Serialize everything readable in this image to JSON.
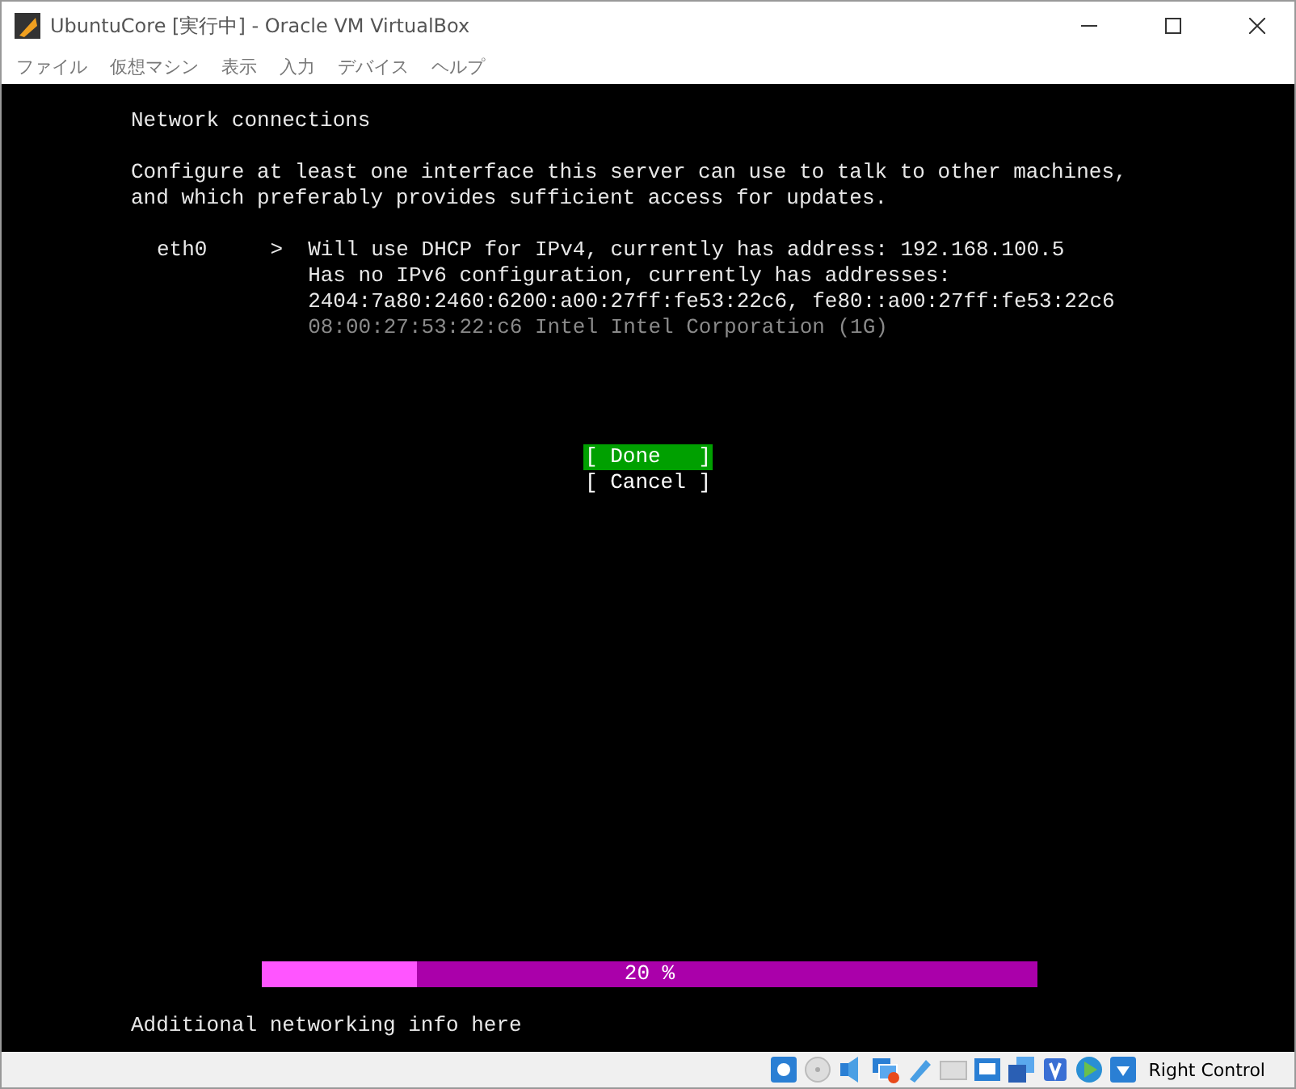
{
  "window": {
    "title": "UbuntuCore [実行中] - Oracle VM VirtualBox"
  },
  "menu": [
    "ファイル",
    "仮想マシン",
    "表示",
    "入力",
    "デバイス",
    "ヘルプ"
  ],
  "console": {
    "heading": "Network connections",
    "description": [
      "Configure at least one interface this server can use to talk to other machines,",
      "and which preferably provides sufficient access for updates."
    ],
    "interfaces": [
      {
        "name": "eth0",
        "arrow": ">",
        "lines": [
          {
            "text": "Will use DHCP for IPv4, currently has address: 192.168.100.5",
            "dim": false
          },
          {
            "text": "Has no IPv6 configuration, currently has addresses:",
            "dim": false
          },
          {
            "text": "2404:7a80:2460:6200:a00:27ff:fe53:22c6, fe80::a00:27ff:fe53:22c6",
            "dim": false
          },
          {
            "text": "08:00:27:53:22:c6 Intel Intel Corporation (1G)",
            "dim": true
          }
        ]
      }
    ],
    "buttons": [
      {
        "label": "[ Done   ]",
        "selected": true
      },
      {
        "label": "[ Cancel ]",
        "selected": false
      }
    ],
    "progress": {
      "level": 0.2,
      "reading": "20 %"
    },
    "footer": "Additional networking info here"
  },
  "status_bar": {
    "host_key": "Right Control"
  }
}
